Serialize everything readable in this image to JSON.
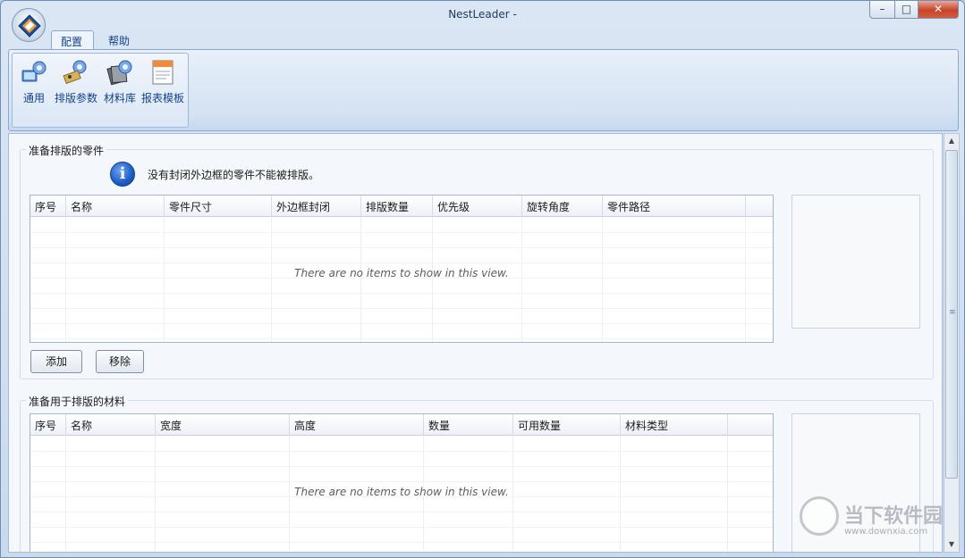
{
  "window": {
    "title": "NestLeader -",
    "minimize": "▭",
    "maximize": "□",
    "close": "✕"
  },
  "ribbon": {
    "tabs": [
      {
        "label": "配置"
      },
      {
        "label": "帮助"
      }
    ],
    "buttons": [
      {
        "label": "通用",
        "icon": "general-settings-icon"
      },
      {
        "label": "排版参数",
        "icon": "nesting-params-icon"
      },
      {
        "label": "材料库",
        "icon": "material-library-icon"
      },
      {
        "label": "报表模板",
        "icon": "report-template-icon"
      }
    ]
  },
  "parts_section": {
    "title": "准备排版的零件",
    "info": "没有封闭外边框的零件不能被排版。",
    "columns": [
      "序号",
      "名称",
      "零件尺寸",
      "外边框封闭",
      "排版数量",
      "优先级",
      "旋转角度",
      "零件路径"
    ],
    "empty_text": "There are no items to show in this view.",
    "add_label": "添加",
    "remove_label": "移除"
  },
  "materials_section": {
    "title": "准备用于排版的材料",
    "columns": [
      "序号",
      "名称",
      "宽度",
      "高度",
      "数量",
      "可用数量",
      "材料类型"
    ],
    "empty_text": "There are no items to show in this view."
  },
  "watermark": {
    "text": "当下软件园",
    "url": "www.downxia.com"
  },
  "colors": {
    "accent": "#15428b",
    "frame": "#c9daee",
    "info": "#1d5bc6"
  }
}
